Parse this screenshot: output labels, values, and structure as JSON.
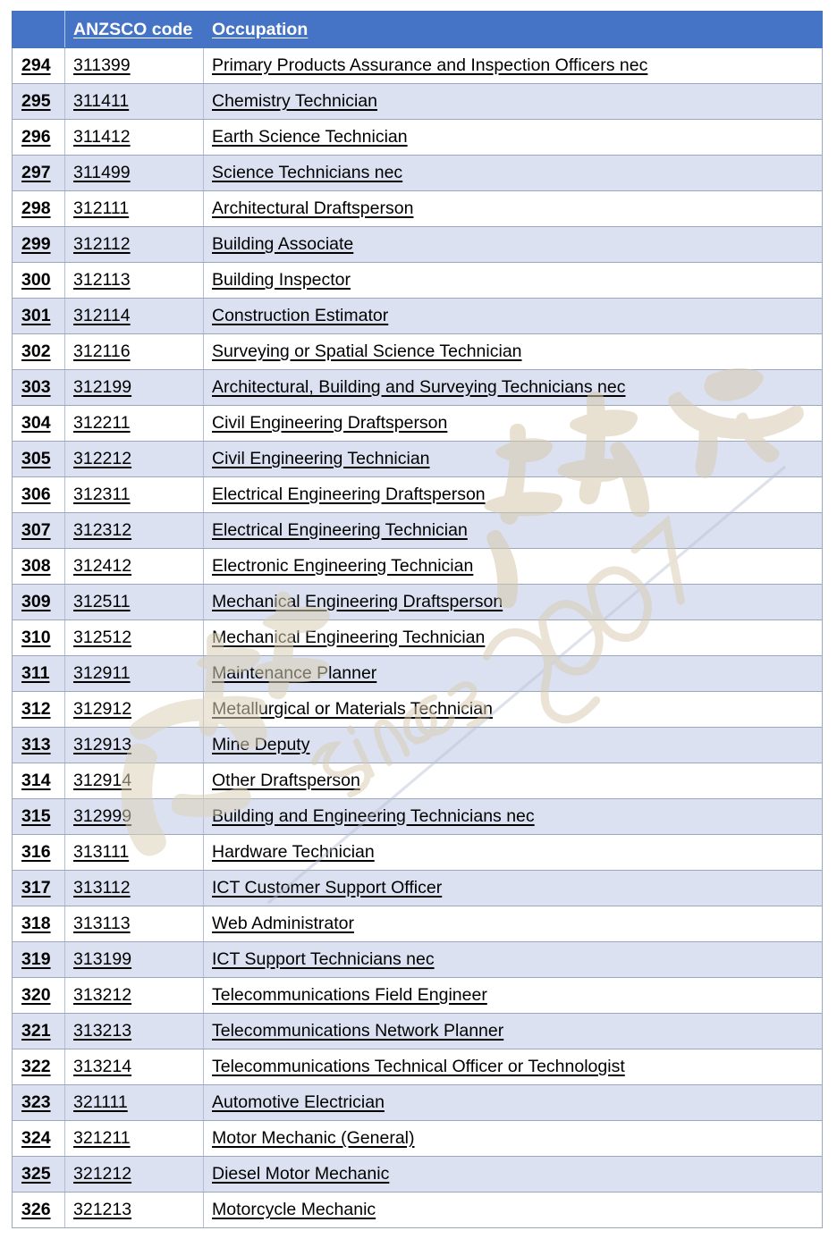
{
  "table": {
    "columns": [
      {
        "key": "no",
        "label": ""
      },
      {
        "key": "code",
        "label": "ANZSCO code"
      },
      {
        "key": "occupation",
        "label": "Occupation"
      }
    ],
    "header_bg": "#4573c6",
    "header_text_color": "#ffffff",
    "stripe_bg": "#dce1f1",
    "base_bg": "#ffffff",
    "grid_color": "#9aa7bd",
    "rows": [
      {
        "no": "294",
        "code": "311399",
        "occupation": "Primary Products Assurance and Inspection Officers nec"
      },
      {
        "no": "295",
        "code": "311411",
        "occupation": "Chemistry Technician"
      },
      {
        "no": "296",
        "code": "311412",
        "occupation": "Earth Science Technician"
      },
      {
        "no": "297",
        "code": "311499",
        "occupation": "Science Technicians nec"
      },
      {
        "no": "298",
        "code": "312111",
        "occupation": "Architectural Draftsperson"
      },
      {
        "no": "299",
        "code": "312112",
        "occupation": "Building Associate"
      },
      {
        "no": "300",
        "code": "312113",
        "occupation": "Building Inspector"
      },
      {
        "no": "301",
        "code": "312114",
        "occupation": "Construction Estimator"
      },
      {
        "no": "302",
        "code": "312116",
        "occupation": "Surveying or Spatial Science Technician"
      },
      {
        "no": "303",
        "code": "312199",
        "occupation": "Architectural, Building and Surveying Technicians nec"
      },
      {
        "no": "304",
        "code": "312211",
        "occupation": "Civil Engineering Draftsperson"
      },
      {
        "no": "305",
        "code": "312212",
        "occupation": "Civil Engineering Technician"
      },
      {
        "no": "306",
        "code": "312311",
        "occupation": "Electrical Engineering Draftsperson"
      },
      {
        "no": "307",
        "code": "312312",
        "occupation": "Electrical Engineering Technician"
      },
      {
        "no": "308",
        "code": "312412",
        "occupation": "Electronic Engineering Technician"
      },
      {
        "no": "309",
        "code": "312511",
        "occupation": "Mechanical Engineering Draftsperson"
      },
      {
        "no": "310",
        "code": "312512",
        "occupation": "Mechanical Engineering Technician"
      },
      {
        "no": "311",
        "code": "312911",
        "occupation": "Maintenance Planner"
      },
      {
        "no": "312",
        "code": "312912",
        "occupation": "Metallurgical or Materials Technician"
      },
      {
        "no": "313",
        "code": "312913",
        "occupation": "Mine Deputy"
      },
      {
        "no": "314",
        "code": "312914",
        "occupation": "Other Draftsperson"
      },
      {
        "no": "315",
        "code": "312999",
        "occupation": "Building and Engineering Technicians nec"
      },
      {
        "no": "316",
        "code": "313111",
        "occupation": "Hardware Technician"
      },
      {
        "no": "317",
        "code": "313112",
        "occupation": "ICT Customer Support Officer"
      },
      {
        "no": "318",
        "code": "313113",
        "occupation": "Web Administrator"
      },
      {
        "no": "319",
        "code": "313199",
        "occupation": "ICT Support Technicians nec"
      },
      {
        "no": "320",
        "code": "313212",
        "occupation": "Telecommunications Field Engineer"
      },
      {
        "no": "321",
        "code": "313213",
        "occupation": "Telecommunications Network Planner"
      },
      {
        "no": "322",
        "code": "313214",
        "occupation": "Telecommunications Technical Officer or Technologist"
      },
      {
        "no": "323",
        "code": "321111",
        "occupation": "Automotive Electrician"
      },
      {
        "no": "324",
        "code": "321211",
        "occupation": "Motor Mechanic (General)"
      },
      {
        "no": "325",
        "code": "321212",
        "occupation": "Diesel Motor Mechanic"
      },
      {
        "no": "326",
        "code": "321213",
        "occupation": "Motorcycle Mechanic"
      }
    ]
  },
  "watermark": {
    "year_text": "since 2007",
    "color": "#d9cdb4"
  }
}
